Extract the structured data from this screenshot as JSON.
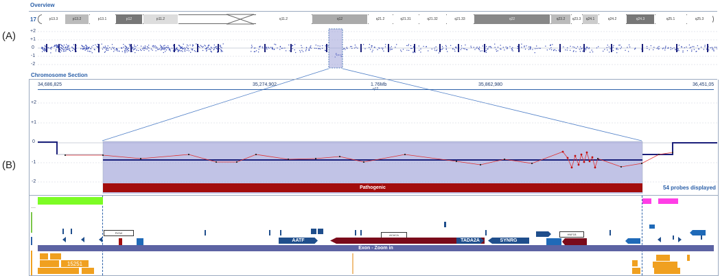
{
  "labels": {
    "a": "(A)",
    "b": "(B)"
  },
  "overview": {
    "title": "Overview",
    "chromosome": "17",
    "bands": [
      "p13.3",
      "p13.2",
      "p13.1",
      "p12",
      "p11.2",
      "q11.2",
      "q12",
      "q21.2",
      "q21.31",
      "q21.32",
      "q21.33",
      "q22",
      "q23.2",
      "q23.3",
      "q24.1",
      "q24.2",
      "q24.3",
      "q25.1",
      "q25.3"
    ],
    "yticks": [
      "+2",
      "+1",
      "0",
      "-1",
      "-2"
    ]
  },
  "section": {
    "title": "Chromosome Section",
    "coords": [
      "34,686,825",
      "35,274,902",
      "1.76Mb",
      "35,862,980",
      "36,451,05"
    ],
    "band_label": "q12",
    "yticks": [
      "+2",
      "+1",
      "0",
      "-1",
      "-2"
    ],
    "pathogenic_label": "Pathogenic",
    "probes_label": "54 probes displayed"
  },
  "tracks": {
    "exon_label": "Exon - Zoom in",
    "genes": [
      "AATF",
      "TADA2A",
      "SYNRG"
    ],
    "small_labels": [
      "PIGW",
      "ACACA",
      "HNF1B"
    ],
    "cnv_label": "15251"
  },
  "colors": {
    "accent": "#2a5fa8",
    "pathogenic": "#a30d0d",
    "selection": "#9fa3d9",
    "gene": "#1f4e8c",
    "exon_bar": "#5c63a3",
    "green": "#7cfc24",
    "magenta": "#ff3ee6",
    "orange": "#f0a020"
  }
}
